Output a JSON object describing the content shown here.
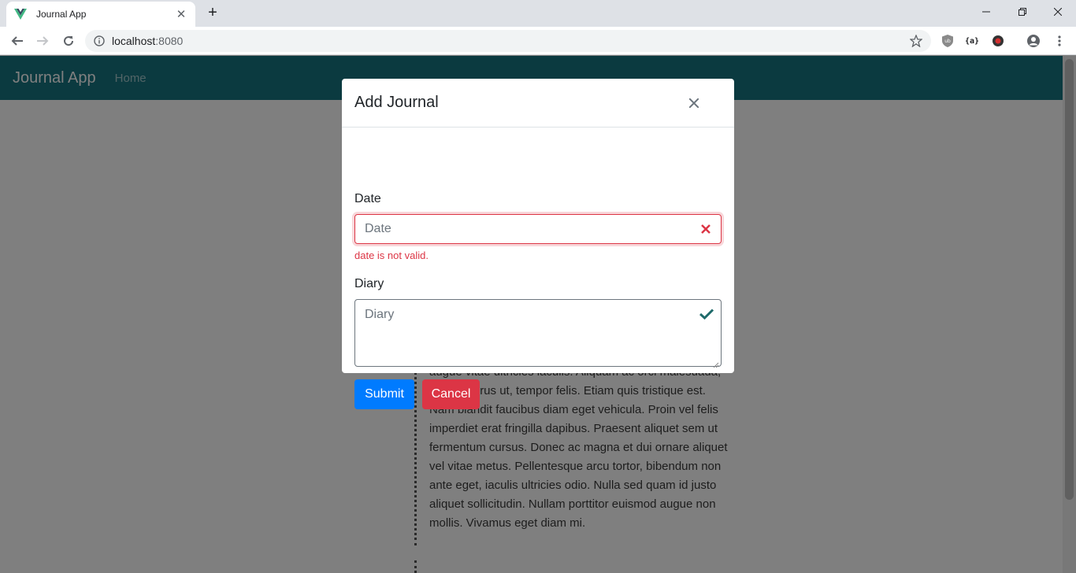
{
  "browser": {
    "tab_title": "Journal App",
    "url_host": "localhost",
    "url_port": ":8080",
    "ext_braces_label": "{a}"
  },
  "app": {
    "brand": "Journal App",
    "nav": {
      "home": "Home"
    },
    "entry_text": "augue vitae ultricies iaculis. Aliquam ac orci malesuada, rutrum purus ut, tempor felis. Etiam quis tristique est. Nam blandit faucibus diam eget vehicula. Proin vel felis imperdiet erat fringilla dapibus. Praesent aliquet sem ut fermentum cursus. Donec ac magna et dui ornare aliquet vel vitae metus. Pellentesque arcu tortor, bibendum non ante eget, iaculis ultricies odio. Nulla sed quam id justo aliquet sollicitudin. Nullam porttitor euismod augue non mollis. Vivamus eget diam mi."
  },
  "modal": {
    "title": "Add Journal",
    "date": {
      "label": "Date",
      "placeholder": "Date",
      "error": "date is not valid."
    },
    "diary": {
      "label": "Diary",
      "placeholder": "Diary"
    },
    "submit_label": "Submit",
    "cancel_label": "Cancel"
  },
  "colors": {
    "navbar": "#177581",
    "primary": "#007bff",
    "danger": "#dc3545",
    "valid": "#1f6b6b"
  }
}
